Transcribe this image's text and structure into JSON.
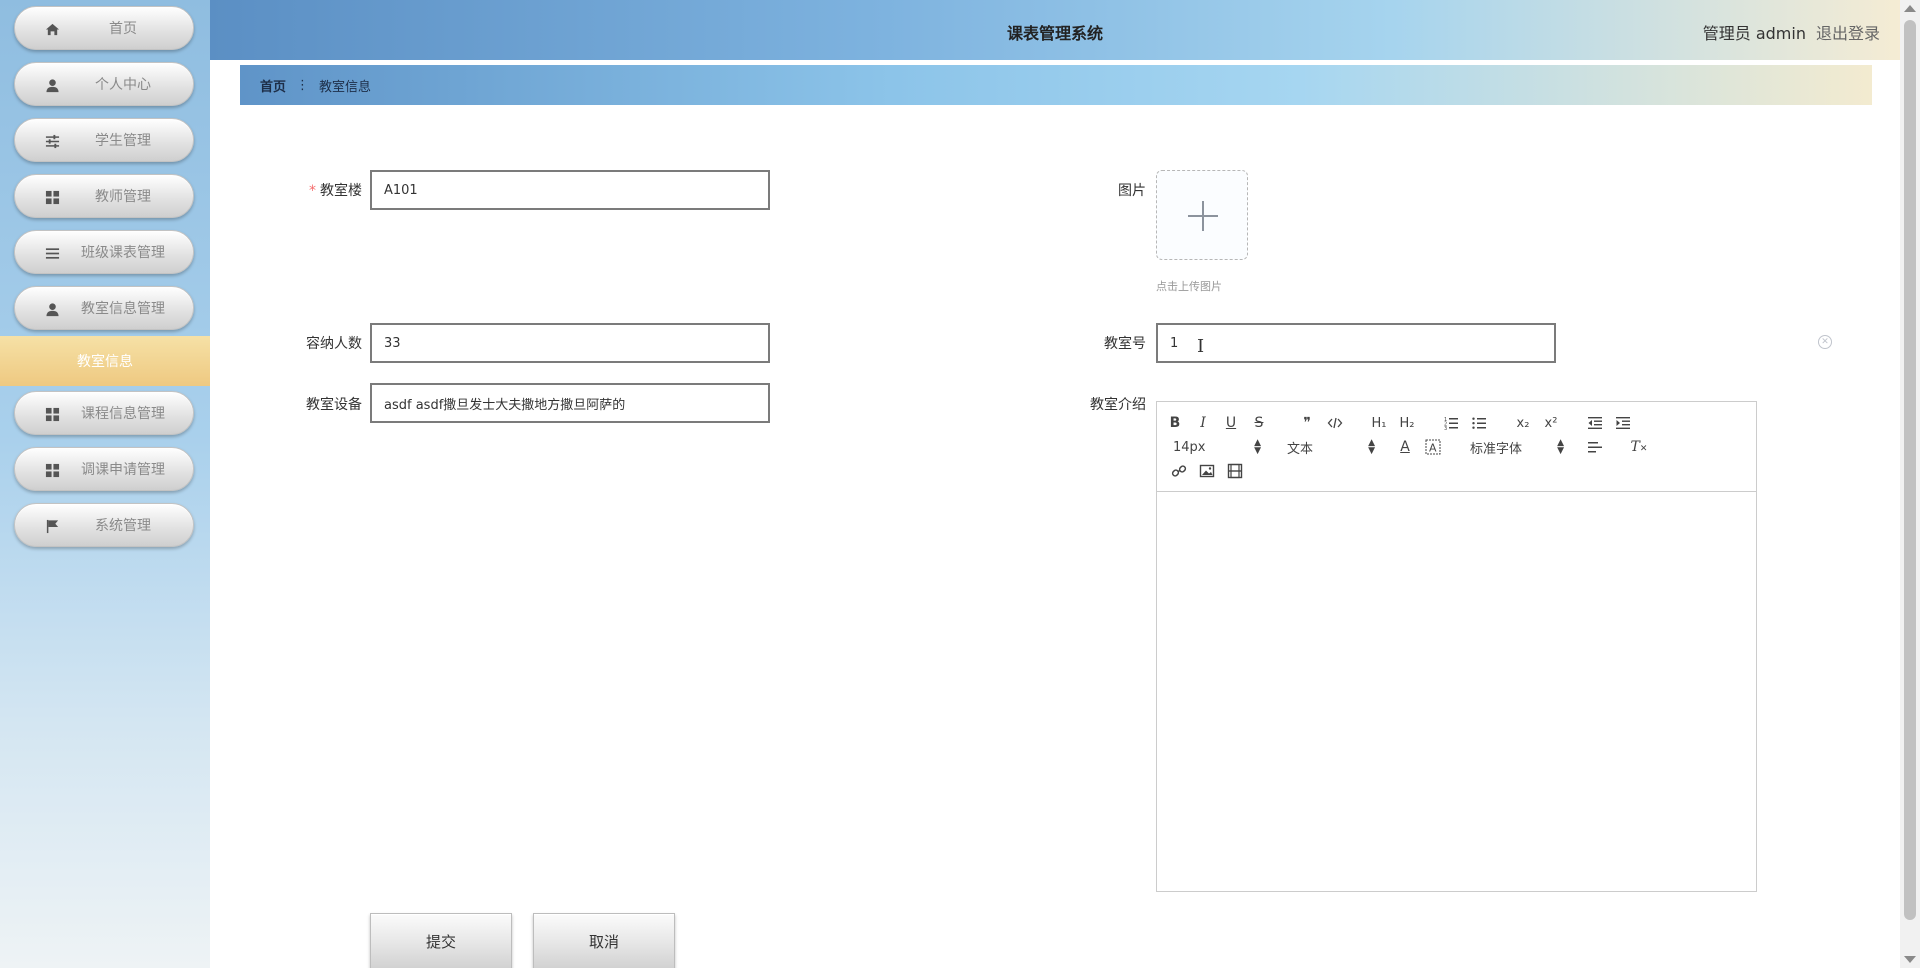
{
  "app": {
    "title": "课表管理系统"
  },
  "user": {
    "label": "管理员 admin",
    "logout": "退出登录"
  },
  "sidebar": {
    "items": [
      {
        "label": "首页",
        "icon": "home-icon"
      },
      {
        "label": "个人中心",
        "icon": "user-icon"
      },
      {
        "label": "学生管理",
        "icon": "sliders-icon"
      },
      {
        "label": "教师管理",
        "icon": "grid-icon"
      },
      {
        "label": "班级课表管理",
        "icon": "list-icon"
      },
      {
        "label": "教室信息管理",
        "icon": "user-icon"
      }
    ],
    "active": {
      "label": "教室信息"
    },
    "items_after": [
      {
        "label": "课程信息管理",
        "icon": "grid-icon"
      },
      {
        "label": "调课申请管理",
        "icon": "grid-icon"
      },
      {
        "label": "系统管理",
        "icon": "flag-icon"
      }
    ]
  },
  "breadcrumb": {
    "home": "首页",
    "separator": "⋮",
    "current": "教室信息"
  },
  "form": {
    "building": {
      "label": "教室楼",
      "required_mark": "*",
      "value": "A101"
    },
    "image": {
      "label": "图片",
      "tip": "点击上传图片"
    },
    "capacity": {
      "label": "容纳人数",
      "value": "33"
    },
    "room_no": {
      "label": "教室号",
      "value": "1"
    },
    "equipment": {
      "label": "教室设备",
      "value": "asdf asdf撒旦发士大夫撒地方撒旦阿萨的"
    },
    "intro": {
      "label": "教室介绍"
    }
  },
  "editor": {
    "font_size": "14px",
    "header_select": "文本",
    "font_family": "标准字体",
    "buttons": {
      "bold": "B",
      "italic": "I",
      "underline": "U",
      "strike": "S",
      "h1": "H₁",
      "h2": "H₂",
      "sub": "x₂",
      "sup": "x²"
    }
  },
  "buttons": {
    "submit": "提交",
    "cancel": "取消"
  }
}
